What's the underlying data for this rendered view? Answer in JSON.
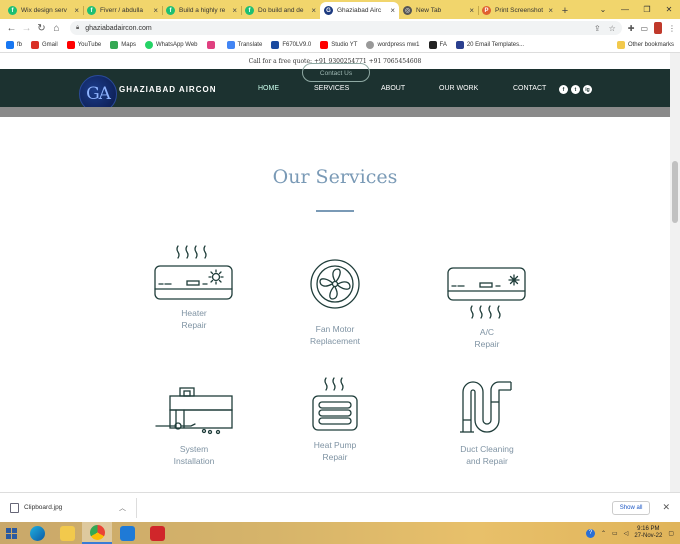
{
  "browser": {
    "tabs": [
      {
        "title": "Wix design serv",
        "fav_color": "#1dbf73",
        "fav_letter": "f"
      },
      {
        "title": "Fiverr / abdulla",
        "fav_color": "#1dbf73",
        "fav_letter": "f"
      },
      {
        "title": "Build a highly re",
        "fav_color": "#1dbf73",
        "fav_letter": "f"
      },
      {
        "title": "Do build and de",
        "fav_color": "#1dbf73",
        "fav_letter": "f"
      },
      {
        "title": "Ghaziabad Airc",
        "fav_color": "#1c3a80",
        "fav_letter": "G",
        "active": true
      },
      {
        "title": "New Tab",
        "fav_color": "#555555",
        "fav_letter": "◎"
      },
      {
        "title": "Print Screenshot",
        "fav_color": "#e06030",
        "fav_letter": "P"
      }
    ],
    "new_tab": "+",
    "url": "ghaziabadaircon.com",
    "bookmarks": [
      {
        "label": "fb",
        "color": "#1877f2"
      },
      {
        "label": "Gmail",
        "color": "#d93025"
      },
      {
        "label": "YouTube",
        "color": "#ff0000"
      },
      {
        "label": "Maps",
        "color": "#34a853"
      },
      {
        "label": "WhatsApp Web",
        "color": "#25d366"
      },
      {
        "label": "",
        "color": "#e04080"
      },
      {
        "label": "Translate",
        "color": "#4285f4"
      },
      {
        "label": "F670LV9.0",
        "color": "#1a4aa0"
      },
      {
        "label": "Studio YT",
        "color": "#ff0000"
      },
      {
        "label": "wordpress mw1",
        "color": "#999999"
      },
      {
        "label": "FA",
        "color": "#222222"
      },
      {
        "label": "20 Email Templates...",
        "color": "#2a3f8f"
      }
    ],
    "other_bookmarks": "Other bookmarks"
  },
  "site": {
    "promo_text": "Call for a free quote: +91 9300254771 +91 7065454608",
    "contact_button": "Contact Us",
    "logo_text": "GA",
    "brand": "GHAZIABAD AIRCON",
    "menu": [
      "HOME",
      "SERVICES",
      "ABOUT",
      "OUR WORK",
      "CONTACT"
    ],
    "social": [
      "f",
      "t",
      "ig"
    ],
    "section_title": "Our Services",
    "services": [
      {
        "line1": "Heater",
        "line2": "Repair",
        "icon": "heater-icon"
      },
      {
        "line1": "Fan Motor",
        "line2": "Replacement",
        "icon": "fan-icon"
      },
      {
        "line1": "A/C",
        "line2": "Repair",
        "icon": "ac-unit-icon"
      },
      {
        "line1": "System",
        "line2": "Installation",
        "icon": "toolbox-icon"
      },
      {
        "line1": "Heat Pump",
        "line2": "Repair",
        "icon": "heat-pump-icon"
      },
      {
        "line1": "Duct Cleaning",
        "line2": "and Repair",
        "icon": "duct-icon"
      }
    ]
  },
  "downloads": {
    "file": "Clipboard.jpg",
    "show_all": "Show all"
  },
  "taskbar": {
    "time": "9:16 PM",
    "date": "27-Nov-22"
  },
  "colors": {
    "navbar": "#1c3230",
    "title": "#7a9ab6",
    "icon_stroke": "#1f3d3a",
    "tabstrip": "#f1d56c"
  }
}
